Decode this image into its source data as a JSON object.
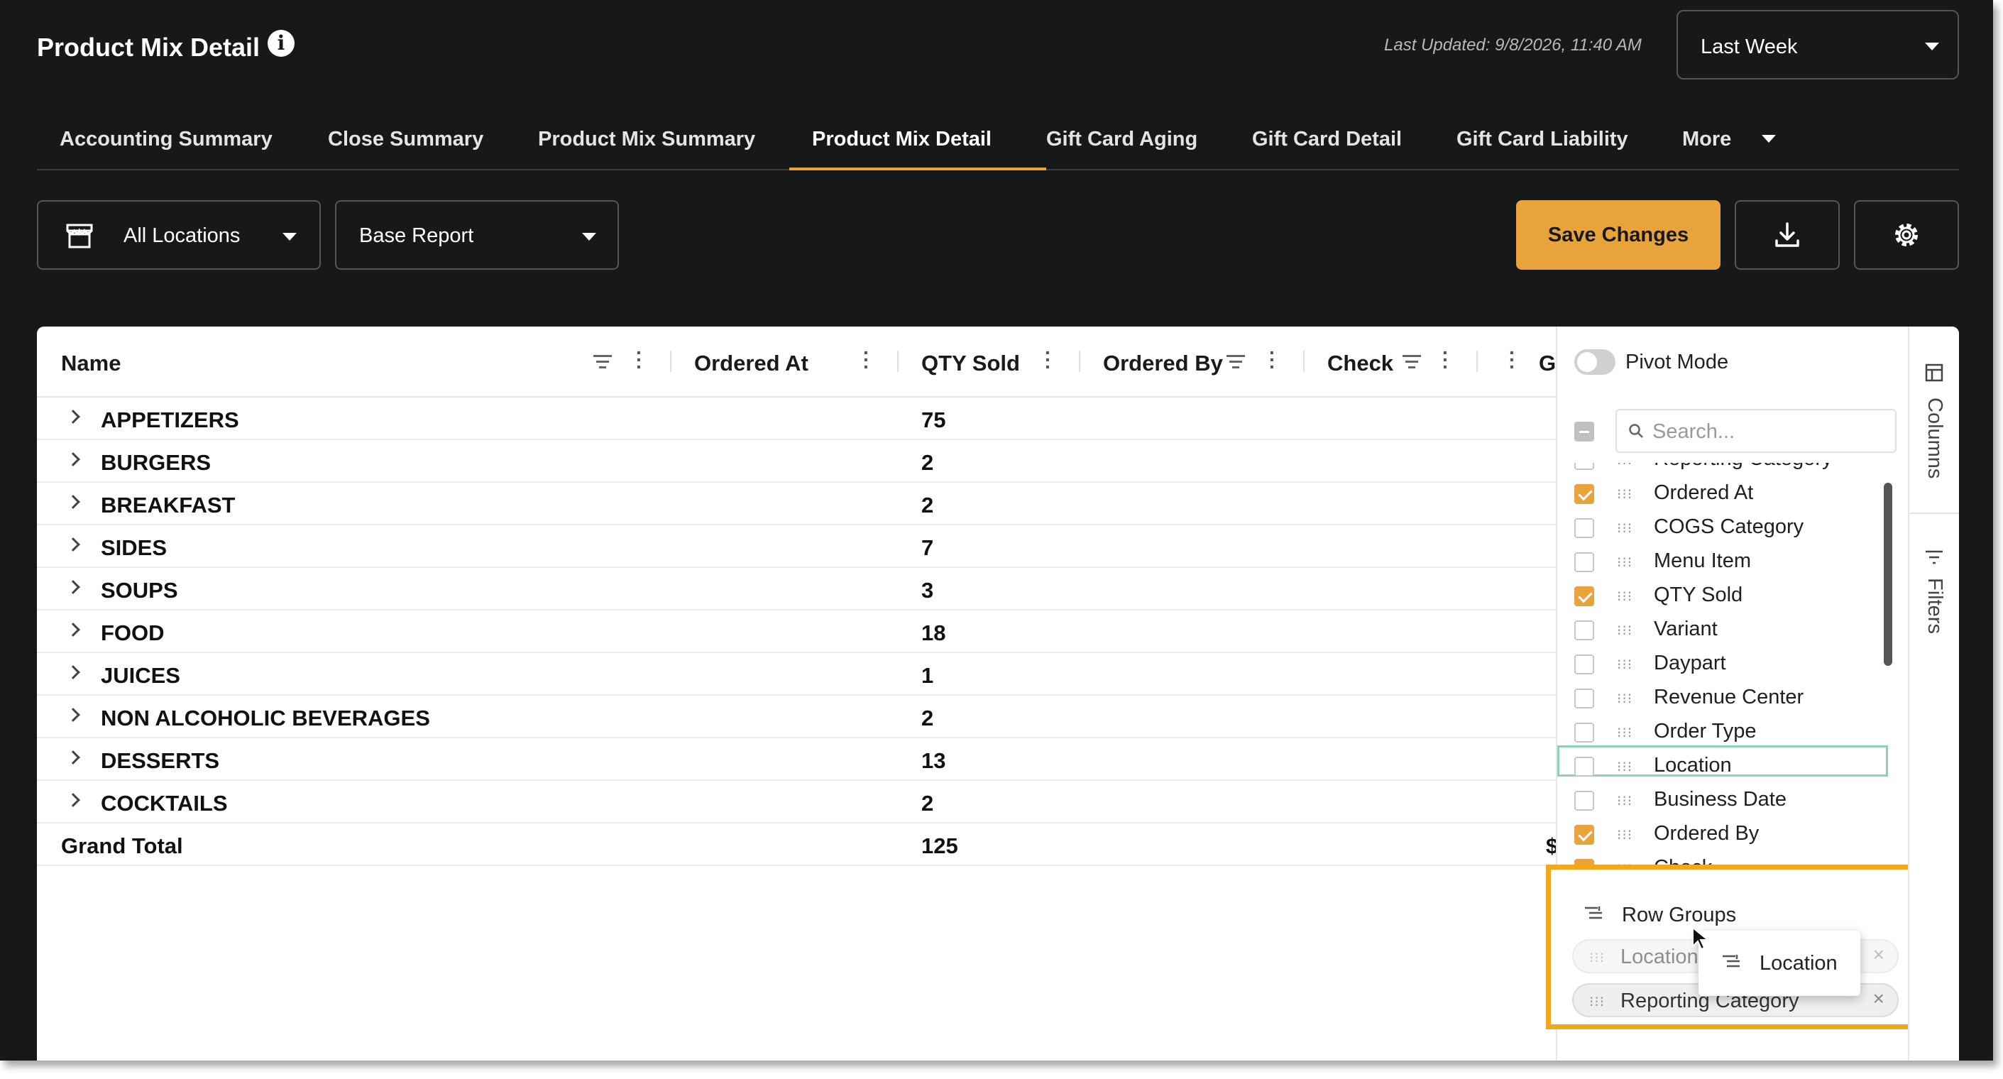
{
  "header": {
    "title": "Product Mix Detail",
    "last_updated": "Last Updated: 9/8/2026, 11:40 AM",
    "date_range": "Last Week"
  },
  "tabs": [
    {
      "label": "Accounting Summary"
    },
    {
      "label": "Close Summary"
    },
    {
      "label": "Product Mix Summary"
    },
    {
      "label": "Product Mix Detail",
      "active": true
    },
    {
      "label": "Gift Card Aging"
    },
    {
      "label": "Gift Card Detail"
    },
    {
      "label": "Gift Card Liability"
    },
    {
      "label": "More"
    }
  ],
  "toolbar": {
    "location_select": "All Locations",
    "report_select": "Base Report",
    "save_label": "Save Changes"
  },
  "grid": {
    "columns": [
      "Name",
      "Ordered At",
      "QTY Sold",
      "Ordered By",
      "Check",
      "G"
    ],
    "rows": [
      {
        "name": "APPETIZERS",
        "qty": "75"
      },
      {
        "name": "BURGERS",
        "qty": "2"
      },
      {
        "name": "BREAKFAST",
        "qty": "2"
      },
      {
        "name": "SIDES",
        "qty": "7"
      },
      {
        "name": "SOUPS",
        "qty": "3"
      },
      {
        "name": "FOOD",
        "qty": "18"
      },
      {
        "name": "JUICES",
        "qty": "1"
      },
      {
        "name": "NON ALCOHOLIC BEVERAGES",
        "qty": "2"
      },
      {
        "name": "DESSERTS",
        "qty": "13"
      },
      {
        "name": "COCKTAILS",
        "qty": "2"
      }
    ],
    "grand_total": {
      "label": "Grand Total",
      "qty": "125",
      "extra": "$"
    }
  },
  "side_panel": {
    "pivot_mode_label": "Pivot Mode",
    "pivot_mode_on": false,
    "search_placeholder": "Search...",
    "columns": [
      {
        "label": "Reporting Category",
        "checked": false
      },
      {
        "label": "Ordered At",
        "checked": true
      },
      {
        "label": "COGS Category",
        "checked": false
      },
      {
        "label": "Menu Item",
        "checked": false
      },
      {
        "label": "QTY Sold",
        "checked": true
      },
      {
        "label": "Variant",
        "checked": false
      },
      {
        "label": "Daypart",
        "checked": false
      },
      {
        "label": "Revenue Center",
        "checked": false
      },
      {
        "label": "Order Type",
        "checked": false
      },
      {
        "label": "Location",
        "checked": false
      },
      {
        "label": "Business Date",
        "checked": false
      },
      {
        "label": "Ordered By",
        "checked": true
      },
      {
        "label": "Check",
        "checked": true
      }
    ],
    "row_groups": {
      "title": "Row Groups",
      "chips": [
        "Location",
        "Reporting Category"
      ],
      "drag_ghost": "Location"
    },
    "side_tabs": [
      "Columns",
      "Filters"
    ]
  },
  "colors": {
    "accent": "#e8a33a",
    "background": "#17181a",
    "highlight_green": "#8fd1b8",
    "drop_zone_border": "#f0a91a"
  }
}
